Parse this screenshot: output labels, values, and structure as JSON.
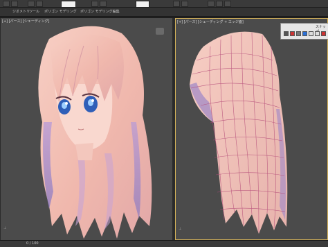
{
  "ribbon": {
    "tabs": [
      "ジオメトリ",
      "ツール",
      "ポリゴン モデリング",
      "ポリゴン モデリング編集"
    ]
  },
  "viewports": {
    "left_label": "[+] [パース] [シェーディング]",
    "right_label": "[+] [パース] [シェーディング + エッジ面]"
  },
  "panel": {
    "title": "スナップ"
  },
  "status": {
    "frame": "0 / 100"
  },
  "colors": {
    "viewport_bg": "#4b4b4b",
    "hair": "#f2bfb6",
    "hair_shadow": "#9c86c8",
    "wire": "#b44a78",
    "active_border": "#d6b35a"
  }
}
